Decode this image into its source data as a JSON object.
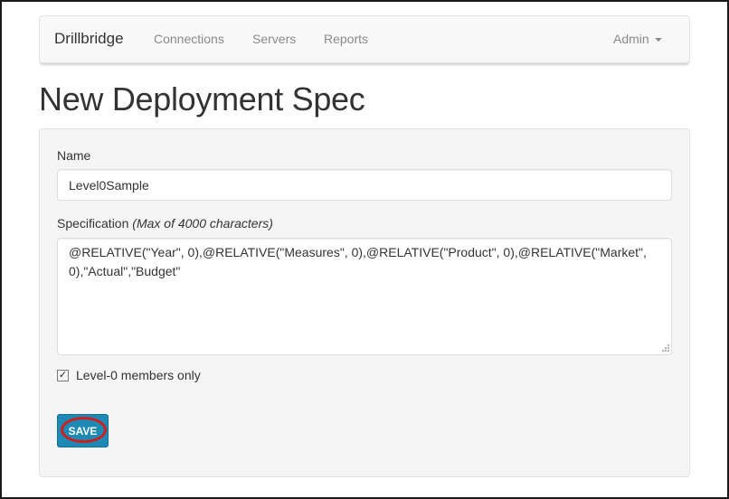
{
  "navbar": {
    "brand": "Drillbridge",
    "links": [
      "Connections",
      "Servers",
      "Reports"
    ],
    "user_menu": "Admin"
  },
  "page": {
    "title": "New Deployment Spec"
  },
  "form": {
    "name_label": "Name",
    "name_value": "Level0Sample",
    "spec_label": "Specification",
    "spec_hint": "(Max of 4000 characters)",
    "spec_value": "@RELATIVE(\"Year\", 0),@RELATIVE(\"Measures\", 0),@RELATIVE(\"Product\", 0),@RELATIVE(\"Market\", 0),\"Actual\",\"Budget\"",
    "level0_checked": true,
    "level0_label": "Level-0 members only",
    "save_label": "SAVE"
  },
  "colors": {
    "accent": "#1c8ab5",
    "annotation": "#cc1f1f"
  }
}
